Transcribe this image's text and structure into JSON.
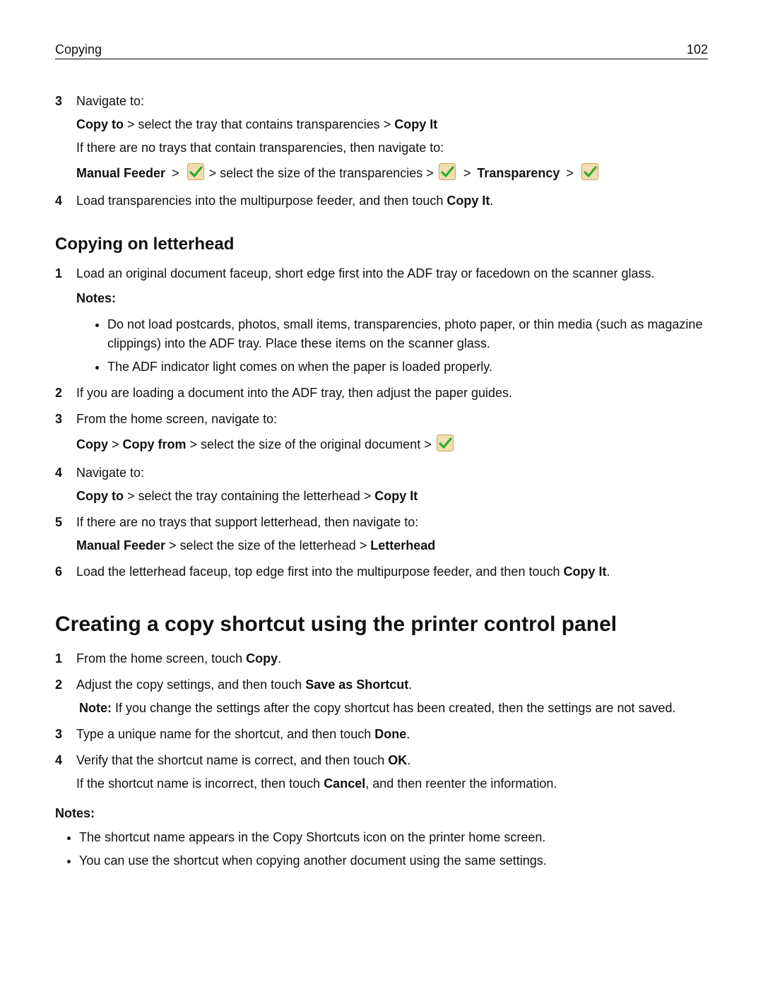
{
  "header": {
    "section": "Copying",
    "page_number": "102"
  },
  "top_steps": {
    "s3": {
      "lead": "Navigate to:",
      "line1_a": "Copy to",
      "line1_mid": " > select the tray that contains transparencies > ",
      "line1_c": "Copy It",
      "line2": "If there are no trays that contain transparencies, then navigate to:",
      "flow_a": "Manual Feeder",
      "flow_gt1": ">",
      "flow_b": " > select the size of the transparencies > ",
      "flow_gt2": ">",
      "flow_c": "Transparency",
      "flow_gt3": ">"
    },
    "s4_a": "Load transparencies into the multipurpose feeder, and then touch ",
    "s4_b": "Copy It",
    "s4_c": "."
  },
  "section_letterhead": {
    "title": "Copying on letterhead",
    "s1": "Load an original document faceup, short edge first into the ADF tray or facedown on the scanner glass.",
    "notes_label": "Notes:",
    "note1": "Do not load postcards, photos, small items, transparencies, photo paper, or thin media (such as magazine clippings) into the ADF tray. Place these items on the scanner glass.",
    "note2": "The ADF indicator light comes on when the paper is loaded properly.",
    "s2": "If you are loading a document into the ADF tray, then adjust the paper guides.",
    "s3_lead": "From the home screen, navigate to:",
    "s3_a": "Copy",
    "s3_gt1": " > ",
    "s3_b": "Copy from",
    "s3_mid": " > select the size of the original document > ",
    "s4_lead": "Navigate to:",
    "s4_a": "Copy to",
    "s4_mid": " > select the tray containing the letterhead > ",
    "s4_b": "Copy It",
    "s5_lead": "If there are no trays that support letterhead, then navigate to:",
    "s5_a": "Manual Feeder",
    "s5_mid": " > select the size of the letterhead > ",
    "s5_b": "Letterhead",
    "s6_a": "Load the letterhead faceup, top edge first into the multipurpose feeder, and then touch ",
    "s6_b": "Copy It",
    "s6_c": "."
  },
  "section_shortcut": {
    "title": "Creating a copy shortcut using the printer control panel",
    "s1_a": "From the home screen, touch ",
    "s1_b": "Copy",
    "s1_c": ".",
    "s2_a": "Adjust the copy settings, and then touch ",
    "s2_b": "Save as Shortcut",
    "s2_c": ".",
    "s2_note_a": "Note:",
    "s2_note_b": " If you change the settings after the copy shortcut has been created, then the settings are not saved.",
    "s3_a": "Type a unique name for the shortcut, and then touch ",
    "s3_b": "Done",
    "s3_c": ".",
    "s4_a": "Verify that the shortcut name is correct, and then touch ",
    "s4_b": "OK",
    "s4_c": ".",
    "s4_line2_a": "If the shortcut name is incorrect, then touch ",
    "s4_line2_b": "Cancel",
    "s4_line2_c": ", and then reenter the information.",
    "notes_label": "Notes:",
    "bn1": "The shortcut name appears in the Copy Shortcuts icon on the printer home screen.",
    "bn2": "You can use the shortcut when copying another document using the same settings."
  },
  "numbers": {
    "n1": "1",
    "n2": "2",
    "n3": "3",
    "n4": "4",
    "n5": "5",
    "n6": "6"
  },
  "icon": {
    "check_alt": "check-icon"
  }
}
